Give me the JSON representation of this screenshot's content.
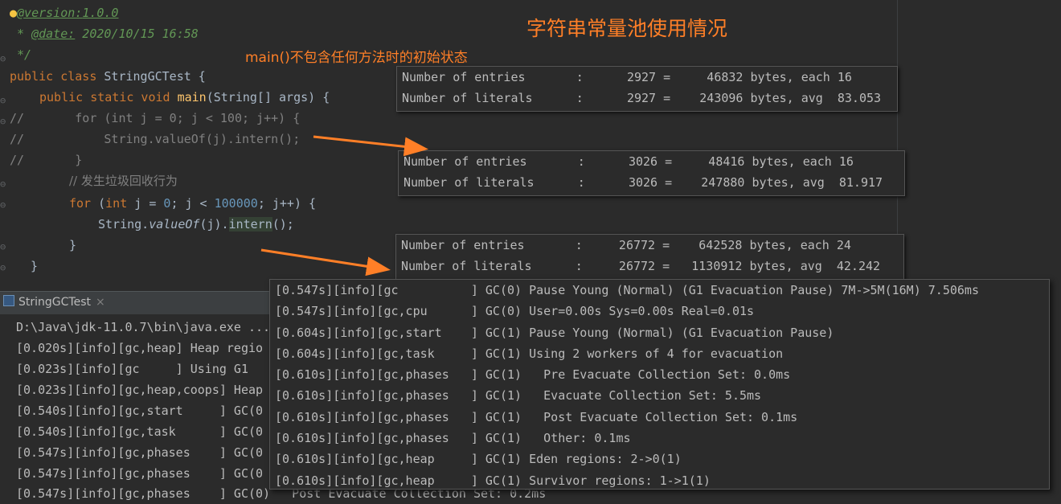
{
  "annotations": {
    "title": "字符串常量池使用情况",
    "subtitle": "main()不包含任何方法时的初始状态"
  },
  "editor": {
    "lines": [
      {
        "indent": " ",
        "pre": "",
        "tag": "@version:",
        "post": "1.0.0"
      },
      {
        "indent": " ",
        "pre": "* ",
        "tag": "@date:",
        "post": " 2020/10/15 16:58"
      },
      {
        "text": " */"
      }
    ],
    "class_kw": "public class ",
    "class_name": "StringGCTest {",
    "main_kw": "public static void ",
    "main_name": "main",
    "main_args": "(String[] args) {",
    "commented": [
      "//       for (int j = 0; j < 100; j++) {",
      "//           String.valueOf(j).intern();",
      "//       }"
    ],
    "comment_cn": "// 发生垃圾回收行为",
    "for_kw1": "for",
    "for_open": " (",
    "for_kw2": "int",
    "for_mid1": " j = ",
    "for_zero": "0",
    "for_mid2": "; j < ",
    "for_max": "100000",
    "for_end": "; j++) {",
    "call_pre": "String.",
    "call_method": "valueOf",
    "call_mid": "(j).",
    "call_intern": "intern",
    "call_end": "();",
    "close_inner": "}",
    "close_outer": "}"
  },
  "stats_box_1": [
    "Number of entries       :      2927 =     46832 bytes, each 16",
    "Number of literals      :      2927 =    243096 bytes, avg  83.053"
  ],
  "stats_box_2": [
    "Number of entries       :      3026 =     48416 bytes, each 16",
    "Number of literals      :      3026 =    247880 bytes, avg  81.917"
  ],
  "stats_box_3": [
    "Number of entries       :     26772 =    642528 bytes, each 24",
    "Number of literals      :     26772 =   1130912 bytes, avg  42.242"
  ],
  "console_tab": {
    "label": "StringGCTest",
    "close": "×"
  },
  "console_lines": [
    "D:\\Java\\jdk-11.0.7\\bin\\java.exe ...",
    "[0.020s][info][gc,heap] Heap regio",
    "[0.023s][info][gc     ] Using G1",
    "[0.023s][info][gc,heap,coops] Heap",
    "[0.540s][info][gc,start     ] GC(0",
    "[0.540s][info][gc,task      ] GC(0",
    "[0.547s][info][gc,phases    ] GC(0",
    "[0.547s][info][gc,phases    ] GC(0",
    "[0.547s][info][gc,phases    ] GC(0)   Post Evacuate Collection Set: 0.2ms"
  ],
  "gc_popup_lines": [
    "[0.547s][info][gc          ] GC(0) Pause Young (Normal) (G1 Evacuation Pause) 7M->5M(16M) 7.506ms",
    "[0.547s][info][gc,cpu      ] GC(0) User=0.00s Sys=0.00s Real=0.01s",
    "[0.604s][info][gc,start    ] GC(1) Pause Young (Normal) (G1 Evacuation Pause)",
    "[0.604s][info][gc,task     ] GC(1) Using 2 workers of 4 for evacuation",
    "[0.610s][info][gc,phases   ] GC(1)   Pre Evacuate Collection Set: 0.0ms",
    "[0.610s][info][gc,phases   ] GC(1)   Evacuate Collection Set: 5.5ms",
    "[0.610s][info][gc,phases   ] GC(1)   Post Evacuate Collection Set: 0.1ms",
    "[0.610s][info][gc,phases   ] GC(1)   Other: 0.1ms",
    "[0.610s][info][gc,heap     ] GC(1) Eden regions: 2->0(1)",
    "[0.610s][info][gc,heap     ] GC(1) Survivor regions: 1->1(1)"
  ],
  "colors": {
    "annotation": "#ff7f27",
    "keyword": "#cc7832",
    "method": "#ffc66d",
    "number": "#6897bb",
    "comment": "#808080",
    "doc": "#629755"
  },
  "icons": {
    "bulb": "lightbulb-icon",
    "fold": "fold-marker-icon",
    "tab": "run-console-icon"
  }
}
